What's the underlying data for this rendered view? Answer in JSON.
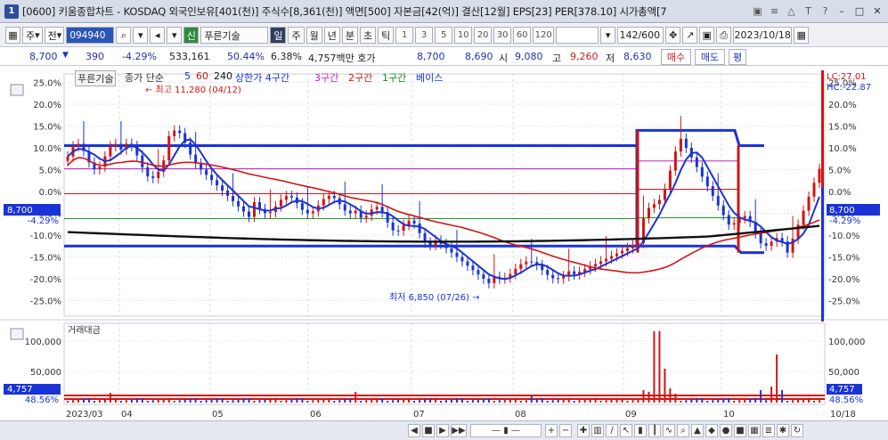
{
  "window": {
    "app_number": "1",
    "title": "[0600] 키움종합차트 - KOSDAQ 외국인보유[401(천)] 주식수[8,361(천)] 액면[500] 자본금[42(억)] 결산[12월] EPS[23] PER[378.10] 시가총액[7",
    "icons": [
      "▣",
      "≡",
      "△",
      "T",
      "?"
    ],
    "controls": [
      "–",
      "□",
      "✕"
    ]
  },
  "toolbar": {
    "market_label": "주",
    "prev_label": "전",
    "stock_code": "094940",
    "stock_name": "푸른기술",
    "new_label": "신",
    "period_day": "일",
    "period_week": "주",
    "period_month": "월",
    "period_year": "년",
    "period_minute": "분",
    "period_second": "초",
    "period_tick": "틱",
    "intervals": [
      "1",
      "3",
      "5",
      "10",
      "20",
      "30",
      "60",
      "120"
    ],
    "count": "142/600",
    "date": "2023/10/18"
  },
  "quote": {
    "price": "8,700",
    "change": "390",
    "change_pct": "-4.29%",
    "volume": "533,161",
    "ratio": "50.44%",
    "turnover": "6.38%",
    "amount": "4,757백만 호가",
    "bid_price": "8,700",
    "ask_price": "8,690",
    "open_label": "시",
    "open": "9,080",
    "high_label": "고",
    "high": "9,260",
    "low_label": "저",
    "low": "8,630",
    "buy_label": "매수",
    "sell_label": "매도",
    "eval_label": "평"
  },
  "legend": {
    "name": "푸른기술",
    "ma_label": "종가 단순",
    "ma5": "5",
    "ma60": "60",
    "ma240": "240",
    "channel": "상한가 4구간",
    "zone3": "3구간",
    "zone2": "2구간",
    "zone1": "1구간",
    "base": "베이스"
  },
  "annotations": {
    "high_label": "← 최고 11,280 (04/12)",
    "low_label": "최저 6,850 (07/26) →",
    "lc": "LC:27.01",
    "hc": "HC:-22.87",
    "price_tag": "8,700",
    "pct_tag": "-4.29%",
    "volume_title": "거래대금",
    "vol_tag": "4,757",
    "vol_pct_tag": "48.56%"
  },
  "axis": {
    "price_pct_ticks": [
      "25.0%",
      "20.0%",
      "15.0%",
      "10.0%",
      "5.0%",
      "0.0%",
      "-5.0%",
      "-10.0%",
      "-15.0%",
      "-20.0%",
      "-25.0%"
    ],
    "volume_ticks": [
      "100,000",
      "50,000"
    ],
    "months": [
      "2023/03",
      "04",
      "05",
      "06",
      "07",
      "08",
      "09",
      "10",
      "10/18"
    ]
  },
  "colors": {
    "up": "#d21414",
    "down": "#1a33d6",
    "ma5": "#1a33d6",
    "ma60": "#d21414",
    "ma240": "#111111",
    "zone3": "#c020c0",
    "zone2": "#d21414",
    "zone1": "#118811",
    "base": "#1a33d6"
  },
  "bottom": {
    "buttons": [
      "◀",
      "■",
      "▶",
      "▶▶"
    ]
  }
}
